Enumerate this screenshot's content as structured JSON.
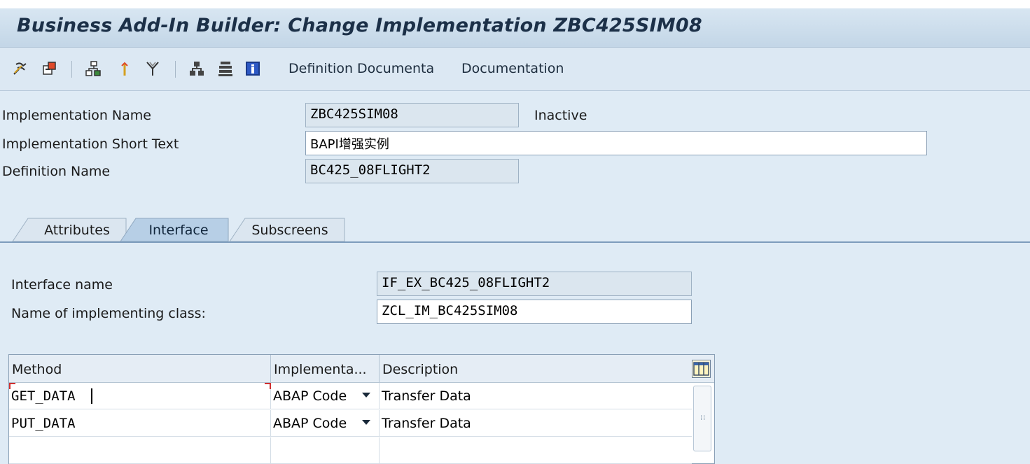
{
  "window": {
    "title": "Business Add-In Builder: Change Implementation ZBC425SIM08"
  },
  "toolbar": {
    "icons": [
      "display-change-icon",
      "activate-icon",
      "hierarchy-icon",
      "where-used-icon",
      "filter-icon",
      "object-list-icon",
      "table-icon",
      "info-icon"
    ],
    "definition_doc_label": "Definition Documenta",
    "documentation_label": "Documentation"
  },
  "header": {
    "impl_name_label": "Implementation Name",
    "impl_name_value": "ZBC425SIM08",
    "impl_status": "Inactive",
    "short_text_label": "Implementation Short Text",
    "short_text_value": "BAPI增强实例",
    "def_name_label": "Definition Name",
    "def_name_value": "BC425_08FLIGHT2"
  },
  "tabs": [
    {
      "label": "Attributes",
      "active": false
    },
    {
      "label": "Interface",
      "active": true
    },
    {
      "label": "Subscreens",
      "active": false
    }
  ],
  "interface": {
    "name_label": "Interface name",
    "name_value": "IF_EX_BC425_08FLIGHT2",
    "class_label": "Name of implementing class:",
    "class_value": "ZCL_IM_BC425SIM08"
  },
  "methods_table": {
    "columns": [
      "Method",
      "Implementa...",
      "Description"
    ],
    "rows": [
      {
        "method": "GET_DATA",
        "impl": "ABAP Code",
        "description": "Transfer Data"
      },
      {
        "method": "PUT_DATA",
        "impl": "ABAP Code",
        "description": "Transfer Data"
      }
    ]
  },
  "colors": {
    "background": "#dfebf5",
    "title_text": "#1c3048",
    "active_tab": "#b7cfe6",
    "readonly_field": "#dbe6ef"
  }
}
